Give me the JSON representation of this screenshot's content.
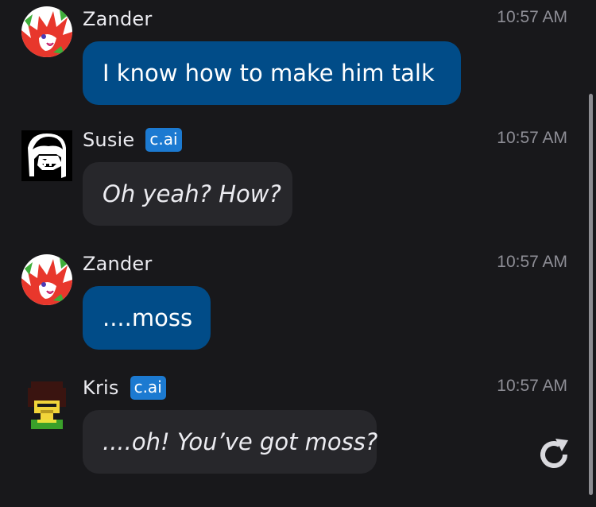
{
  "messages": [
    {
      "author": "Zander",
      "role": "user",
      "badge": "",
      "time": "10:57 AM",
      "text": "I know how to make him talk",
      "avatar_icon": "fox-avatar-icon"
    },
    {
      "author": "Susie",
      "role": "bot",
      "badge": "c.ai",
      "time": "10:57 AM",
      "text": "Oh yeah? How?",
      "avatar_icon": "susie-avatar-icon"
    },
    {
      "author": "Zander",
      "role": "user",
      "badge": "",
      "time": "10:57 AM",
      "text": "....moss",
      "avatar_icon": "fox-avatar-icon"
    },
    {
      "author": "Kris",
      "role": "bot",
      "badge": "c.ai",
      "time": "10:57 AM",
      "text": "....oh! You’ve got moss?",
      "avatar_icon": "kris-avatar-icon"
    }
  ],
  "controls": {
    "regenerate_icon": "refresh-icon"
  },
  "colors": {
    "background": "#18181b",
    "user_bubble": "#014c88",
    "bot_bubble": "#27272b",
    "badge": "#1c7ad1",
    "timestamp": "#8e8e96"
  }
}
